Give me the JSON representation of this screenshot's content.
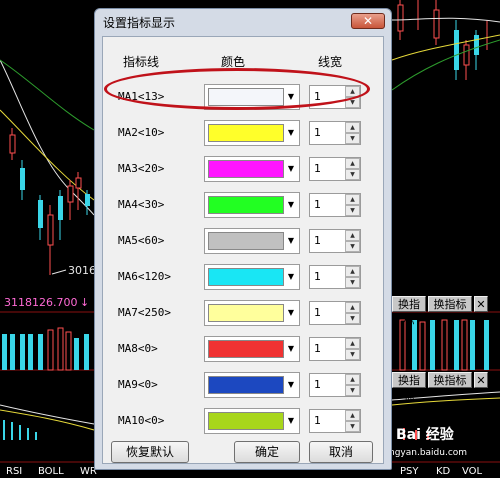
{
  "dialog": {
    "title": "设置指标显示",
    "close_glyph": "✕",
    "headers": {
      "line": "指标线",
      "color": "颜色",
      "width": "线宽"
    },
    "rows": [
      {
        "label": "MA1<13>",
        "color": "#f4f6fa",
        "width": "1"
      },
      {
        "label": "MA2<10>",
        "color": "#ffff2a",
        "width": "1"
      },
      {
        "label": "MA3<20>",
        "color": "#ff14ff",
        "width": "1"
      },
      {
        "label": "MA4<30>",
        "color": "#22ff22",
        "width": "1"
      },
      {
        "label": "MA5<60>",
        "color": "#c0c0c0",
        "width": "1"
      },
      {
        "label": "MA6<120>",
        "color": "#19e6f4",
        "width": "1"
      },
      {
        "label": "MA7<250>",
        "color": "#ffff9c",
        "width": "1"
      },
      {
        "label": "MA8<0>",
        "color": "#f03232",
        "width": "1"
      },
      {
        "label": "MA9<0>",
        "color": "#1c48c0",
        "width": "1"
      },
      {
        "label": "MA10<0>",
        "color": "#a8d61c",
        "width": "1"
      }
    ],
    "buttons": {
      "reset": "恢复默认",
      "ok": "确定",
      "cancel": "取消"
    }
  },
  "background": {
    "low_label": "3016",
    "price_label": "3118126.700",
    "price_arrow": "↓",
    "btn_switch": "换指标",
    "btn_switch2": "换指标",
    "btn_close": "✕",
    "btn_close2": "✕",
    "tab_labels": [
      "RSI",
      "BOLL",
      "WR",
      "PSY",
      "KD",
      "VOL"
    ],
    "watermark": "Bai 经验",
    "watermark_url": "jingyan.baidu.com"
  },
  "colors": {
    "highlight": "#c0121a",
    "accent_cyan": "#3ad6e8",
    "pink": "#ff6ad5"
  }
}
